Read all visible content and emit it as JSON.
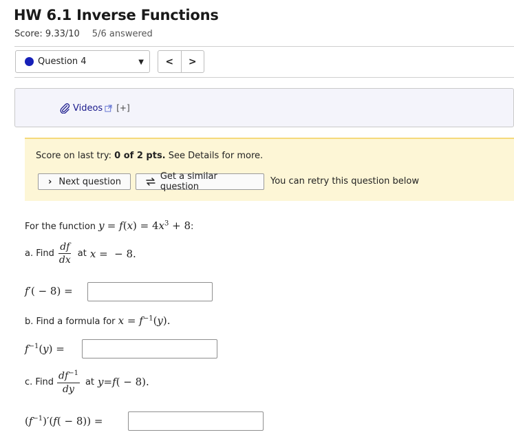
{
  "header": {
    "title": "HW 6.1 Inverse Functions",
    "score": "Score: 9.33/10",
    "answered": "5/6 answered"
  },
  "question_nav": {
    "selected_question": "Question 4",
    "prev_label": "<",
    "next_label": ">"
  },
  "resources": {
    "videos_label": "Videos",
    "expand_label": "[+]"
  },
  "feedback": {
    "last_try_prefix": "Score on last try:",
    "last_try_score": "0 of 2 pts.",
    "last_try_suffix": "See Details for more.",
    "next_question_label": "Next question",
    "similar_question_label": "Get a similar question",
    "retry_text": "You can retry this question below"
  },
  "problem": {
    "intro_text": "For the function",
    "part_a_label": "a. Find",
    "part_a_at": "at",
    "part_b_text": "b. Find a formula for",
    "part_c_label": "c. Find",
    "part_c_at": "at",
    "answers": {
      "a_value": "",
      "b_value": "",
      "c_value": ""
    }
  },
  "colors": {
    "question_dot": "#1620b8",
    "feedback_bg": "#fdf6d6",
    "resource_bg": "#f4f4fb"
  }
}
